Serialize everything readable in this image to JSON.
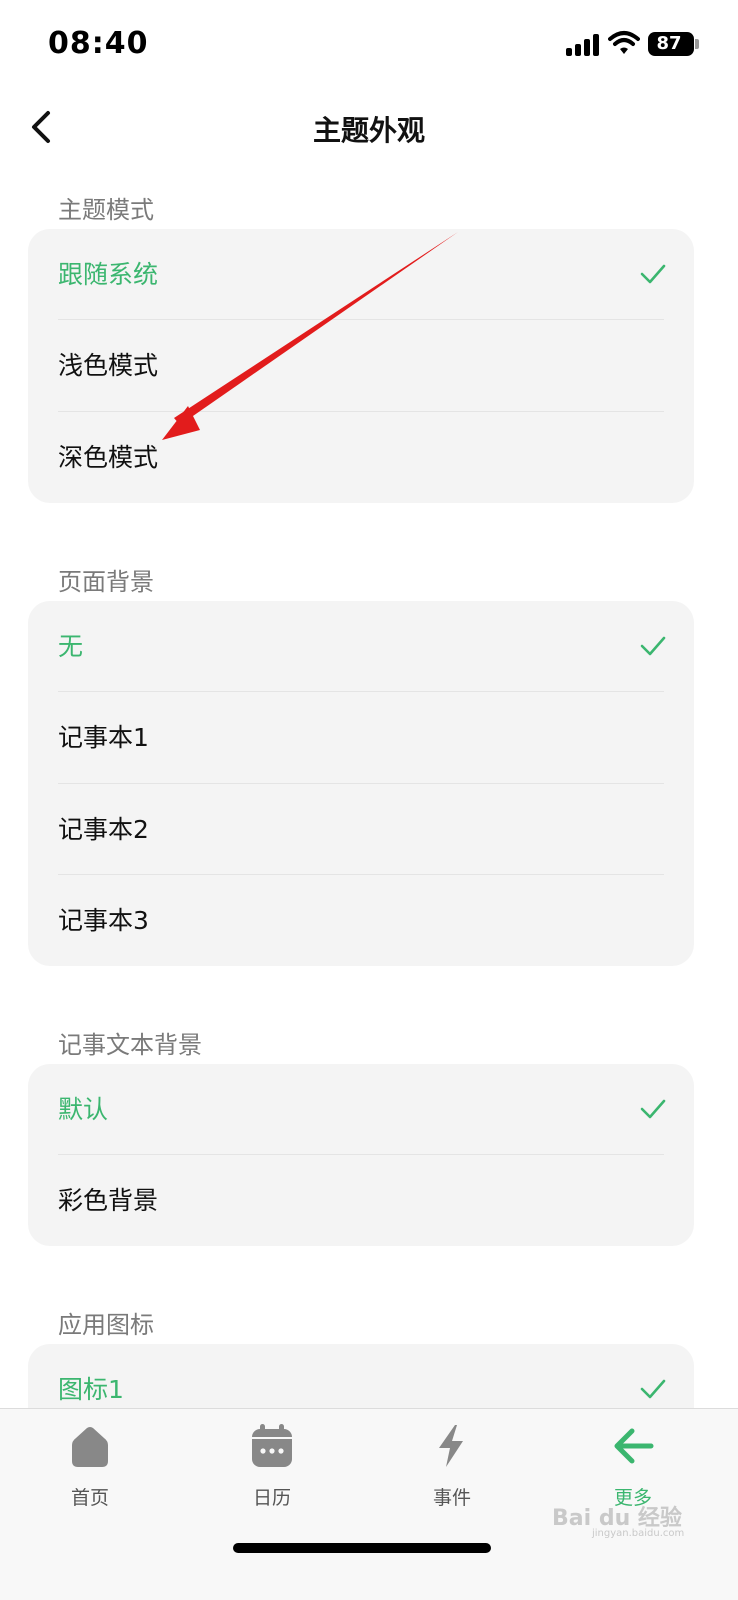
{
  "status_bar": {
    "time": "08:40",
    "battery": "87"
  },
  "nav": {
    "title": "主题外观"
  },
  "sections": [
    {
      "label": "主题模式",
      "items": [
        {
          "label": "跟随系统",
          "selected": true
        },
        {
          "label": "浅色模式",
          "selected": false
        },
        {
          "label": "深色模式",
          "selected": false
        }
      ]
    },
    {
      "label": "页面背景",
      "items": [
        {
          "label": "无",
          "selected": true
        },
        {
          "label": "记事本1",
          "selected": false
        },
        {
          "label": "记事本2",
          "selected": false
        },
        {
          "label": "记事本3",
          "selected": false
        }
      ]
    },
    {
      "label": "记事文本背景",
      "items": [
        {
          "label": "默认",
          "selected": true
        },
        {
          "label": "彩色背景",
          "selected": false
        }
      ]
    },
    {
      "label": "应用图标",
      "items": [
        {
          "label": "图标1",
          "selected": true
        }
      ]
    }
  ],
  "tabbar": {
    "tabs": [
      {
        "label": "首页",
        "icon": "home-icon"
      },
      {
        "label": "日历",
        "icon": "calendar-icon"
      },
      {
        "label": "事件",
        "icon": "lightning-icon"
      },
      {
        "label": "更多",
        "icon": "arrow-left-icon",
        "active": true
      }
    ]
  },
  "watermark": {
    "text": "Bai du 经验",
    "sub": "jingyan.baidu.com"
  },
  "colors": {
    "accent": "#3bb66f",
    "card": "#f4f4f4",
    "annotation": "#e21c1c"
  }
}
